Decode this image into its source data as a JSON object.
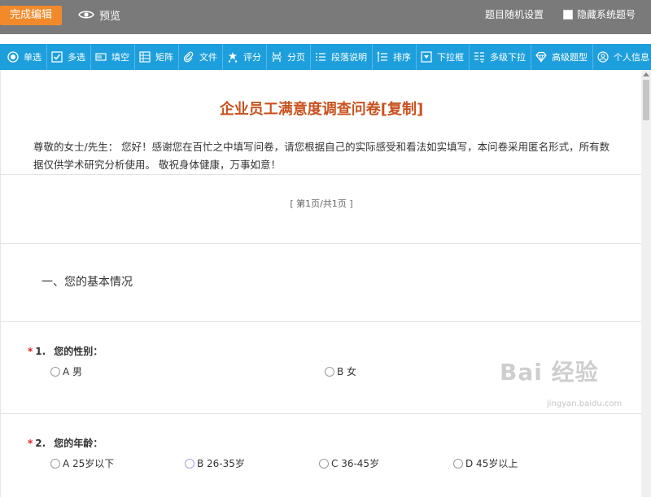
{
  "topbar": {
    "done_label": "完成编辑",
    "preview_label": "预览",
    "random_label": "题目随机设置",
    "hide_label": "隐藏系统题号"
  },
  "toolbar": {
    "items": [
      {
        "label": "单选",
        "icon": "radio-icon"
      },
      {
        "label": "多选",
        "icon": "checkbox-icon"
      },
      {
        "label": "填空",
        "icon": "fill-blank-icon"
      },
      {
        "label": "矩阵",
        "icon": "matrix-icon"
      },
      {
        "label": "文件",
        "icon": "paperclip-icon"
      },
      {
        "label": "评分",
        "icon": "rating-icon"
      },
      {
        "label": "分页",
        "icon": "page-break-icon"
      },
      {
        "label": "段落说明",
        "icon": "paragraph-icon"
      },
      {
        "label": "排序",
        "icon": "sort-icon"
      },
      {
        "label": "下拉框",
        "icon": "dropdown-icon"
      },
      {
        "label": "多级下拉",
        "icon": "multilevel-dropdown-icon"
      },
      {
        "label": "高级题型",
        "icon": "advanced-icon"
      },
      {
        "label": "个人信息",
        "icon": "person-icon"
      }
    ]
  },
  "survey": {
    "title": "企业员工满意度调查问卷[复制]",
    "intro": "尊敬的女士/先生： 您好！感谢您在百忙之中填写问卷，请您根据自己的实际感受和看法如实填写，本问卷采用匿名形式，所有数据仅供学术研究分析使用。 敬祝身体健康，万事如意！",
    "page_info": "[ 第1页/共1页 ]",
    "section": "一、您的基本情况",
    "questions": [
      {
        "star": "*",
        "number": "1.",
        "text": "您的性别：",
        "options": [
          "A 男",
          "B 女"
        ]
      },
      {
        "star": "*",
        "number": "2.",
        "text": "您的年龄：",
        "options": [
          "A 25岁以下",
          "B 26-35岁",
          "C 36-45岁",
          "D 45岁以上"
        ]
      }
    ]
  },
  "watermark": {
    "text": "Bai 经验",
    "sub": "jingyan.baidu.com"
  },
  "colors": {
    "topbar": "#7a7a7a",
    "done_button": "#f28a2b",
    "toolbar": "#1e9fdd",
    "title": "#c9521f",
    "required_star": "#e02020"
  }
}
